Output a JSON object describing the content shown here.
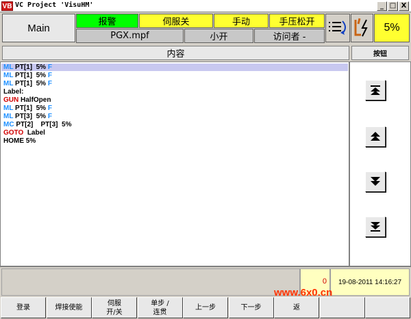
{
  "window": {
    "app_icon_text": "VB",
    "title": "VC Project 'VisuHM'",
    "minimize": "_",
    "maximize": "□",
    "close": "X"
  },
  "header": {
    "main_label": "Main",
    "status": [
      {
        "label": "报警",
        "color": "#00ff00"
      },
      {
        "label": "伺服关",
        "color": "#ffff30"
      },
      {
        "label": "手动",
        "color": "#ffff30"
      },
      {
        "label": "手压松开",
        "color": "#ffff30"
      }
    ],
    "info": {
      "program": "PGX.mpf",
      "mode": "小开",
      "user": "访问者 -"
    },
    "speed": "5%"
  },
  "columns": {
    "content": "内容",
    "buttons": "按钮"
  },
  "program_lines": [
    {
      "kw": "ML",
      "kw_color": "blue",
      "text": " PT[1]  5% ",
      "suffix": "F"
    },
    {
      "kw": "ML",
      "kw_color": "blue",
      "text": " PT[1]  5% ",
      "suffix": "F"
    },
    {
      "kw": "ML",
      "kw_color": "blue",
      "text": " PT[1]  5% ",
      "suffix": "F"
    },
    {
      "kw": "",
      "kw_color": "",
      "text": "Label:",
      "suffix": ""
    },
    {
      "kw": "GUN",
      "kw_color": "red",
      "text": " HalfOpen",
      "suffix": ""
    },
    {
      "kw": "ML",
      "kw_color": "blue",
      "text": " PT[1]  5% ",
      "suffix": "F"
    },
    {
      "kw": "ML",
      "kw_color": "blue",
      "text": " PT[3]  5% ",
      "suffix": "F"
    },
    {
      "kw": "MC",
      "kw_color": "blue",
      "text": " PT[2]    PT[3]  5%",
      "suffix": ""
    },
    {
      "kw": "GOTO",
      "kw_color": "red",
      "text": "  Label",
      "suffix": ""
    },
    {
      "kw": "",
      "kw_color": "",
      "text": "HOME 5%",
      "suffix": ""
    }
  ],
  "status_bar": {
    "alarm_count": "0",
    "datetime": "19-08-2011 14:16:27"
  },
  "softkeys": [
    {
      "line1": "登录",
      "line2": ""
    },
    {
      "line1": "焊接使能",
      "line2": ""
    },
    {
      "line1": "伺服",
      "line2": "开/关"
    },
    {
      "line1": "单步 /",
      "line2": "连贯"
    },
    {
      "line1": "上一步",
      "line2": ""
    },
    {
      "line1": "下一步",
      "line2": ""
    },
    {
      "line1": "返",
      "line2": ""
    },
    {
      "line1": "",
      "line2": ""
    },
    {
      "line1": "",
      "line2": ""
    }
  ],
  "watermark": "www.6x0.cn",
  "icons": {
    "list": "list-arrow-icon",
    "robot": "robot-arm-icon",
    "nav": [
      "first-page-icon",
      "page-up-icon",
      "page-down-icon",
      "last-page-icon"
    ]
  }
}
